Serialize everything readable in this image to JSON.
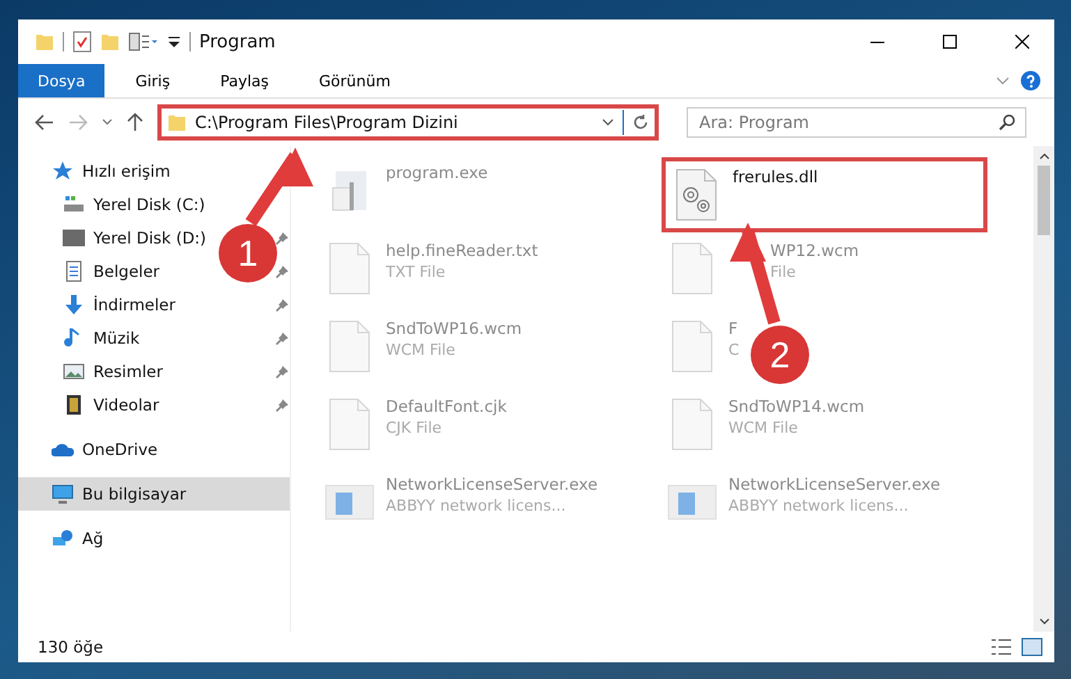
{
  "window": {
    "title": "Program"
  },
  "tabs": [
    {
      "label": "Dosya",
      "selected": true
    },
    {
      "label": "Giriş",
      "selected": false
    },
    {
      "label": "Paylaş",
      "selected": false
    },
    {
      "label": "Görünüm",
      "selected": false
    }
  ],
  "address": {
    "path": "C:\\Program Files\\Program Dizini",
    "highlighted": true
  },
  "search": {
    "placeholder": "Ara: Program"
  },
  "sidebar": {
    "items": [
      {
        "label": "Hızlı erişim",
        "kind": "star",
        "pinned": false,
        "selected": false,
        "children": [
          {
            "label": "Yerel Disk (C:)",
            "kind": "disk-c",
            "pinned": false,
            "selected": false
          },
          {
            "label": "Yerel Disk (D:)",
            "kind": "disk",
            "pinned": true,
            "selected": false
          },
          {
            "label": "Belgeler",
            "kind": "docs",
            "pinned": true,
            "selected": false
          },
          {
            "label": "İndirmeler",
            "kind": "download",
            "pinned": true,
            "selected": false
          },
          {
            "label": "Müzik",
            "kind": "music",
            "pinned": true,
            "selected": false
          },
          {
            "label": "Resimler",
            "kind": "pictures",
            "pinned": true,
            "selected": false
          },
          {
            "label": "Videolar",
            "kind": "video",
            "pinned": true,
            "selected": false
          }
        ]
      },
      {
        "label": "OneDrive",
        "kind": "cloud",
        "pinned": false,
        "selected": false
      },
      {
        "label": "Bu bilgisayar",
        "kind": "pc",
        "pinned": false,
        "selected": true
      },
      {
        "label": "Ağ",
        "kind": "network",
        "pinned": false,
        "selected": false
      }
    ]
  },
  "files": [
    {
      "name": "program.exe",
      "kind": "exe",
      "faded": true,
      "highlighted": false
    },
    {
      "name": "frerules.dll",
      "kind": "dll",
      "faded": false,
      "highlighted": true
    },
    {
      "name": "help.fineReader.txt",
      "type": "TXT File",
      "kind": "doc",
      "faded": true,
      "highlighted": false
    },
    {
      "name": "WP12.wcm",
      "type": "File",
      "kind": "doc",
      "faded": true,
      "highlighted": false,
      "covered": true
    },
    {
      "name": "SndToWP16.wcm",
      "type": "WCM File",
      "kind": "doc",
      "faded": true,
      "highlighted": false
    },
    {
      "name": "F",
      "type": "C",
      "kind": "doc",
      "faded": true,
      "highlighted": false
    },
    {
      "name": "DefaultFont.cjk",
      "type": "CJK File",
      "kind": "doc",
      "faded": true,
      "highlighted": false
    },
    {
      "name": "SndToWP14.wcm",
      "type": "WCM File",
      "kind": "doc",
      "faded": true,
      "highlighted": false
    },
    {
      "name": "NetworkLicenseServer.exe",
      "type": "ABBYY network licens...",
      "kind": "app",
      "faded": true,
      "highlighted": false
    },
    {
      "name": "NetworkLicenseServer.exe",
      "type": "ABBYY network licens...",
      "kind": "app",
      "faded": true,
      "highlighted": false
    }
  ],
  "callouts": [
    {
      "number": "1"
    },
    {
      "number": "2"
    }
  ],
  "status_bar": {
    "count": "130 öğe"
  }
}
